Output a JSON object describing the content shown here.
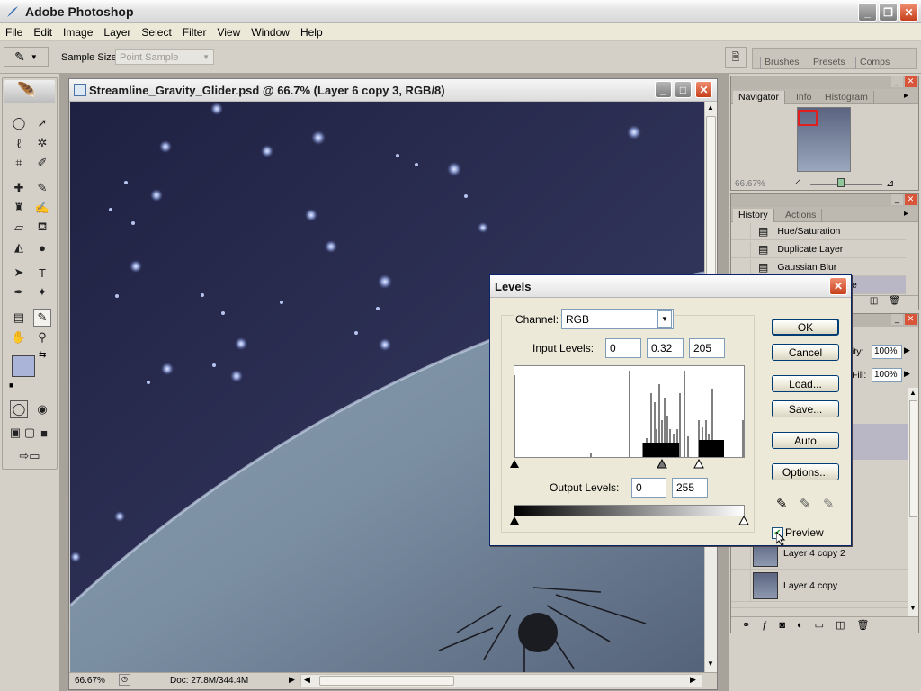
{
  "app": {
    "title": "Adobe Photoshop"
  },
  "menu": [
    "File",
    "Edit",
    "Image",
    "Layer",
    "Select",
    "Filter",
    "View",
    "Window",
    "Help"
  ],
  "options": {
    "sample_size_label": "Sample Size:",
    "sample_size_value": "Point Sample"
  },
  "palette_well": {
    "tabs": [
      "Brushes",
      "Presets",
      "Comps"
    ]
  },
  "document": {
    "title": "Streamline_Gravity_Glider.psd @ 66.7% (Layer 6 copy 3, RGB/8)",
    "zoom": "66.67%",
    "doc_info": "Doc: 27.8M/344.4M"
  },
  "navigator": {
    "tabs": [
      "Navigator",
      "Info",
      "Histogram"
    ],
    "zoom": "66.67%"
  },
  "history": {
    "tabs": [
      "History",
      "Actions"
    ],
    "items": [
      "Hue/Saturation",
      "Duplicate Layer",
      "Gaussian Blur",
      "e"
    ]
  },
  "layers": {
    "opacity_label": "ity:",
    "opacity_value": "100%",
    "fill_label": "Fill:",
    "fill_value": "100%",
    "items": [
      "Layer 4 copy 2",
      "Layer 4 copy"
    ]
  },
  "levels": {
    "title": "Levels",
    "channel_label": "Channel:",
    "channel_value": "RGB",
    "input_label": "Input Levels:",
    "input_values": [
      "0",
      "0.32",
      "205"
    ],
    "output_label": "Output Levels:",
    "output_values": [
      "0",
      "255"
    ],
    "buttons": {
      "ok": "OK",
      "cancel": "Cancel",
      "load": "Load...",
      "save": "Save...",
      "auto": "Auto",
      "options": "Options..."
    },
    "preview_label": "Preview",
    "preview_checked": true
  }
}
